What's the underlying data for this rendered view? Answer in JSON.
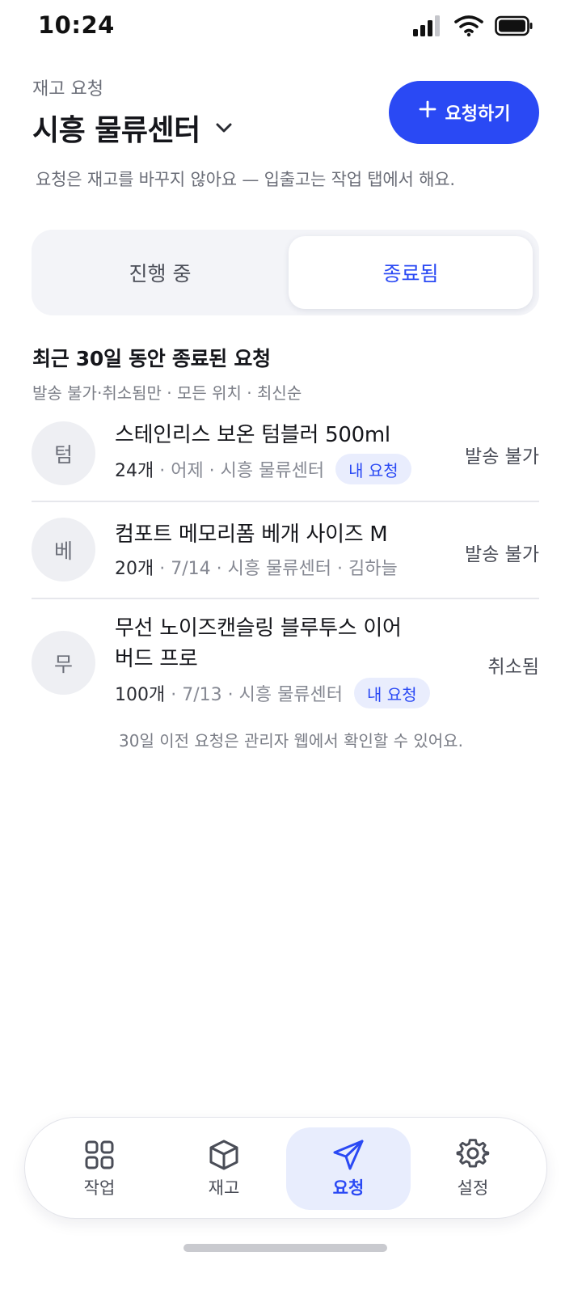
{
  "status_bar": {
    "time": "10:24"
  },
  "header": {
    "eyebrow": "재고 요청",
    "title": "시흥 물류센터",
    "new_button_label": "요청하기"
  },
  "hint": "요청은 재고를 바꾸지 않아요 — 입출고는 작업 탭에서 해요.",
  "segments": {
    "in_progress": "진행 중",
    "closed": "종료됨",
    "selected": "종료됨"
  },
  "section": {
    "title": "최근 30일 동안 종료된 요청",
    "filter": "발송 불가·취소됨만 · 모든 위치 · 최신순"
  },
  "requests": [
    {
      "avatar": "텀",
      "name": "스테인리스 보온 텀블러 500ml",
      "qty": "24개",
      "meta": " · 어제 · 시흥 물류센터",
      "tag": "내 요청",
      "status": "발송 불가"
    },
    {
      "avatar": "베",
      "name": "컴포트 메모리폼 베개 사이즈 M",
      "qty": "20개",
      "meta": " · 7/14 · 시흥 물류센터 · 김하늘",
      "tag": "",
      "status": "발송 불가"
    },
    {
      "avatar": "무",
      "name": "무선 노이즈캔슬링 블루투스 이어버드 프로",
      "qty": "100개",
      "meta": " · 7/13 · 시흥 물류센터",
      "tag": "내 요청",
      "status": "취소됨"
    }
  ],
  "footnote": "30일 이전 요청은 관리자 웹에서 확인할 수 있어요.",
  "tabbar": {
    "items": [
      {
        "label": "작업",
        "icon": "grid-icon"
      },
      {
        "label": "재고",
        "icon": "box-icon"
      },
      {
        "label": "요청",
        "icon": "send-icon"
      },
      {
        "label": "설정",
        "icon": "gear-icon"
      }
    ],
    "active": "요청"
  },
  "colors": {
    "accent": "#2a49f4",
    "accent_soft": "#e8edfd",
    "text_primary": "#15161b",
    "text_secondary": "#6b6e78"
  }
}
